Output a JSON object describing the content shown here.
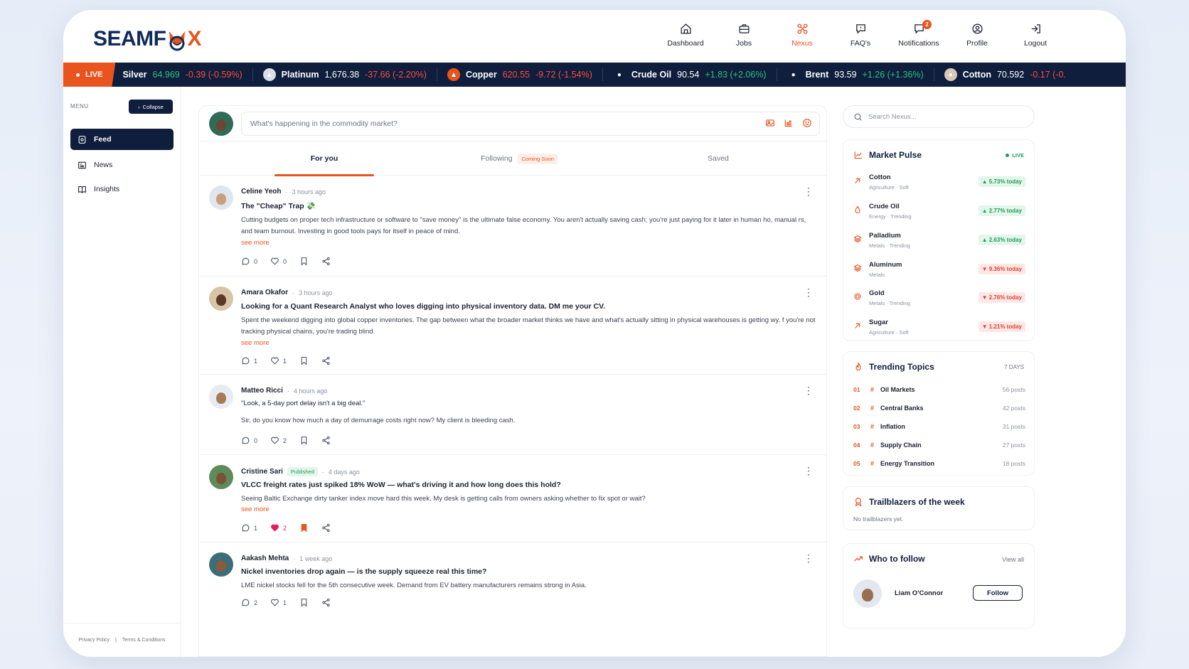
{
  "brand": {
    "logo_text_left": "SEAMF",
    "logo_text_right": "X"
  },
  "nav": [
    {
      "label": "Dashboard",
      "icon": "home-icon"
    },
    {
      "label": "Jobs",
      "icon": "briefcase-icon"
    },
    {
      "label": "Nexus",
      "icon": "nexus-icon",
      "active": true
    },
    {
      "label": "FAQ's",
      "icon": "faq-icon"
    },
    {
      "label": "Notifications",
      "icon": "bell-icon",
      "badge": "2"
    },
    {
      "label": "Profile",
      "icon": "user-circle-icon"
    },
    {
      "label": "Logout",
      "icon": "logout-icon"
    }
  ],
  "ticker": {
    "live_label": "LIVE",
    "items": [
      {
        "name": "Silver",
        "price": "64.969",
        "change": "-0.39 (-0.59%)",
        "dir": "down"
      },
      {
        "name": "Platinum",
        "price": "1,676.38",
        "change": "-37.66 (-2.20%)",
        "dir": "down"
      },
      {
        "name": "Copper",
        "price": "620.55",
        "change": "-9.72 (-1.54%)",
        "dir": "down",
        "price_colored": true
      },
      {
        "name": "Crude Oil",
        "price": "90.54",
        "change": "+1.83 (+2.06%)",
        "dir": "up"
      },
      {
        "name": "Brent",
        "price": "93.59",
        "change": "+1.26 (+1.36%)",
        "dir": "up"
      },
      {
        "name": "Cotton",
        "price": "70.592",
        "change": "-0.17 (-0.",
        "dir": "down"
      }
    ]
  },
  "sidebar": {
    "menu_label": "MENU",
    "collapse_label": "Collapse",
    "items": [
      {
        "label": "Feed",
        "icon": "feed-icon",
        "active": true
      },
      {
        "label": "News",
        "icon": "news-icon"
      },
      {
        "label": "Insights",
        "icon": "book-icon"
      }
    ],
    "footer": {
      "privacy": "Privacy Policy",
      "sep": "|",
      "terms": "Terms & Conditions"
    }
  },
  "composer": {
    "placeholder": "What's happening in the commodity market?"
  },
  "tabs": {
    "for_you": "For you",
    "following": "Following",
    "following_badge": "Coming Soon",
    "saved": "Saved"
  },
  "posts": [
    {
      "author": "Celine Yeoh",
      "sep": "·",
      "time": "3 hours ago",
      "title": "The \"Cheap\" Trap 💸",
      "body": "Cutting budgets on proper tech infrastructure or software to \"save money\" is the ultimate false economy. You aren't actually saving cash; you're just paying for it later in human ho, manual rs, and team burnout. Investing in good tools pays for itself in peace of mind.",
      "see_more": "see more",
      "comments": "0",
      "likes": "0"
    },
    {
      "author": "Amara Okafor",
      "sep": "·",
      "time": "3 hours ago",
      "title": "Looking for a Quant Research Analyst who loves digging into physical inventory data. DM me your CV.",
      "body": "Spent the weekend digging into global copper inventories. The gap between what the broader market thinks we have and what's actually sitting in physical warehouses is getting wy. f you're not tracking physical chains, you're trading blind.",
      "see_more": "see more",
      "comments": "1",
      "likes": "1"
    },
    {
      "author": "Matteo Ricci",
      "sep": "·",
      "time": "4 hours ago",
      "title": "\"Look, a 5-day port delay isn't a big deal.\"",
      "body": "Sir, do you know how much a day of demurrage costs right now? My client is bleeding cash.",
      "comments": "0",
      "likes": "2"
    },
    {
      "author": "Cristine Sari",
      "badge": "Published",
      "sep": "·",
      "time": "4 days ago",
      "title": "VLCC freight rates just spiked 18% WoW — what's driving it and how long does this hold?",
      "body": "Seeing Baltic Exchange dirty tanker index move hard this week. My desk is getting calls from owners asking whether to fix spot or wait?",
      "see_more": "see more",
      "comments": "1",
      "likes": "2",
      "liked": true,
      "saved": true
    },
    {
      "author": "Aakash Mehta",
      "sep": "·",
      "time": "1 week ago",
      "title": "Nickel inventories drop again — is the supply squeeze real this time?",
      "body": "LME nickel stocks fell for the 5th consecutive week. Demand from EV battery manufacturers remains strong in Asia.",
      "comments": "2",
      "likes": "1"
    }
  ],
  "search": {
    "placeholder": "Search Nexus..."
  },
  "market_pulse": {
    "title": "Market Pulse",
    "live": "LIVE",
    "items": [
      {
        "name": "Cotton",
        "sub": "Agriculture · Soft",
        "change": "▲ 5.73% today",
        "dir": "up"
      },
      {
        "name": "Crude Oil",
        "sub": "Energy · Trending",
        "change": "▲ 2.77% today",
        "dir": "up"
      },
      {
        "name": "Palladium",
        "sub": "Metals · Trending",
        "change": "▲ 2.63% today",
        "dir": "up"
      },
      {
        "name": "Aluminum",
        "sub": "Metals",
        "change": "▼ 9.36% today",
        "dir": "down"
      },
      {
        "name": "Gold",
        "sub": "Metals · Trending",
        "change": "▼ 2.76% today",
        "dir": "down"
      },
      {
        "name": "Sugar",
        "sub": "Agriculture · Soft",
        "change": "▼ 1.21% today",
        "dir": "down"
      }
    ]
  },
  "trending": {
    "title": "Trending Topics",
    "period": "7 DAYS",
    "hash": "#",
    "items": [
      {
        "rank": "01",
        "topic": "Oil Markets",
        "count": "56 posts"
      },
      {
        "rank": "02",
        "topic": "Central Banks",
        "count": "42 posts"
      },
      {
        "rank": "03",
        "topic": "Inflation",
        "count": "31 posts"
      },
      {
        "rank": "04",
        "topic": "Supply Chain",
        "count": "27 posts"
      },
      {
        "rank": "05",
        "topic": "Energy Transition",
        "count": "18 posts"
      }
    ]
  },
  "trailblazers": {
    "title": "Trailblazers of the week",
    "empty": "No trailblazers yet."
  },
  "who_to_follow": {
    "title": "Who to follow",
    "view_all": "View all",
    "user": {
      "name": "Liam O'Connor",
      "button": "Follow"
    }
  },
  "colors": {
    "accent": "#e9541e",
    "navy": "#0f1e3d",
    "up": "#1f9d55",
    "down": "#e23c2e"
  }
}
